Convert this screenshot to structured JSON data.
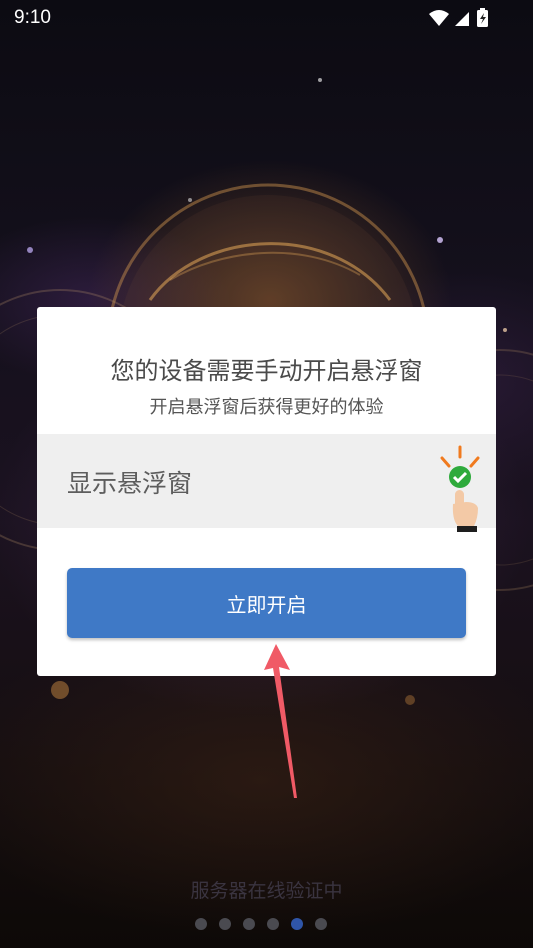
{
  "status_bar": {
    "time": "9:10",
    "icons": [
      "wifi-icon",
      "cellular-signal-icon",
      "battery-charging-icon"
    ]
  },
  "dialog": {
    "title": "您的设备需要手动开启悬浮窗",
    "subtitle": "开启悬浮窗后获得更好的体验",
    "permission_label": "显示悬浮窗",
    "permission_icon": "hand-tap-check-icon",
    "open_button_label": "立即开启"
  },
  "footer": {
    "server_status": "服务器在线验证中",
    "page_count": 6,
    "active_page": 5
  },
  "colors": {
    "accent": "#3f79c6",
    "check_green": "#2eaa3c",
    "arrow_red": "#f05a66",
    "active_dot": "#2f55a8"
  }
}
